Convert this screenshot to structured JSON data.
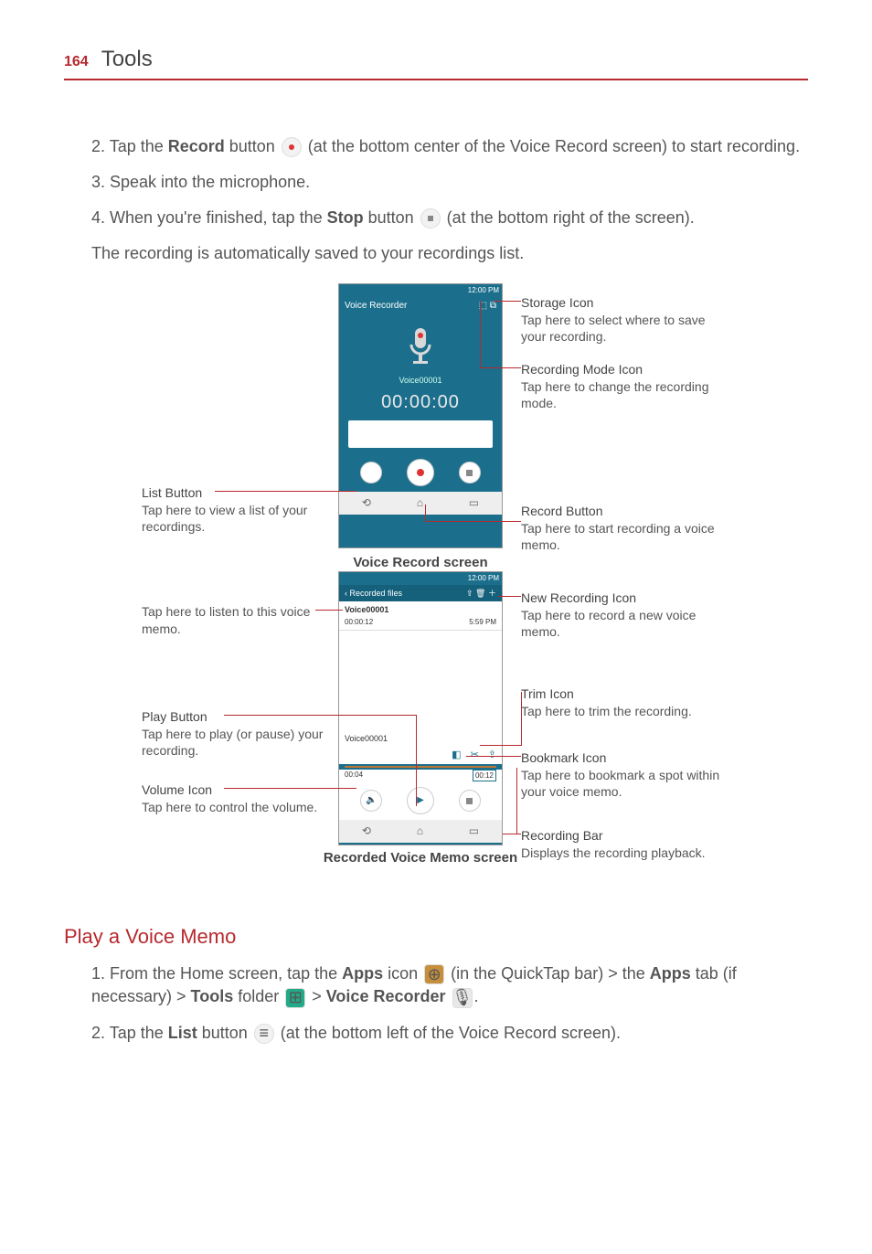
{
  "header": {
    "page_number": "164",
    "chapter_title": "Tools"
  },
  "steps": {
    "s2_a": "2.  Tap the ",
    "s2_bold": "Record",
    "s2_b": " button ",
    "s2_c": " (at the bottom center of the Voice Record screen) to start recording.",
    "s3": "3.  Speak into the microphone.",
    "s4_a": "4.  When you're finished, tap the ",
    "s4_bold": "Stop",
    "s4_b": " button ",
    "s4_c": " (at the bottom right of the screen).",
    "s4_para": "The recording is automatically saved to your recordings list."
  },
  "phone1": {
    "time": "12:00 PM",
    "title": "Voice Recorder",
    "filename": "Voice00001",
    "timer": "00:00:00",
    "caption": "Voice Record screen"
  },
  "phone2": {
    "time": "12:00 PM",
    "header": "Recorded files",
    "file_name": "Voice00001",
    "file_dur": "00:00:12",
    "file_time": "5:59 PM",
    "bp_name": "Voice00001",
    "t_start": "00:04",
    "t_end": "00:12",
    "caption": "Recorded Voice Memo screen"
  },
  "labels": {
    "list_btn_t": "List Button",
    "list_btn_d": "Tap here to view a list of your recordings.",
    "storage_t": "Storage Icon",
    "storage_d": "Tap here to select where to save your recording.",
    "recmode_t": "Recording Mode Icon",
    "recmode_d": "Tap here to change the recording mode.",
    "recbtn_t": "Record Button",
    "recbtn_d": "Tap here to start recording a voice memo.",
    "listen_d": "Tap here to listen to this voice memo.",
    "newrec_t": "New Recording Icon",
    "newrec_d": "Tap here to record a new voice memo.",
    "play_t": "Play Button",
    "play_d": "Tap here to play (or pause) your recording.",
    "vol_t": "Volume Icon",
    "vol_d": "Tap here to control the volume.",
    "trim_t": "Trim Icon",
    "trim_d": "Tap here to trim the recording.",
    "bkmk_t": "Bookmark Icon",
    "bkmk_d": "Tap here to bookmark a spot within your voice memo.",
    "recbar_t": "Recording Bar",
    "recbar_d": "Displays the recording playback."
  },
  "section2": {
    "heading": "Play a Voice Memo",
    "s1_a": "1.  From the Home screen, tap the ",
    "s1_apps": "Apps",
    "s1_b": " icon ",
    "s1_c": " (in the QuickTap bar) > the ",
    "s1_apps2": "Apps",
    "s1_d": " tab (if necessary) > ",
    "s1_tools": "Tools",
    "s1_e": " folder ",
    "s1_f": " > ",
    "s1_vr": "Voice Recorder",
    "s1_g": " ",
    "s1_h": ".",
    "s2_a": "2.  Tap the ",
    "s2_list": "List",
    "s2_b": " button ",
    "s2_c": " (at the bottom left of the Voice Record screen)."
  }
}
